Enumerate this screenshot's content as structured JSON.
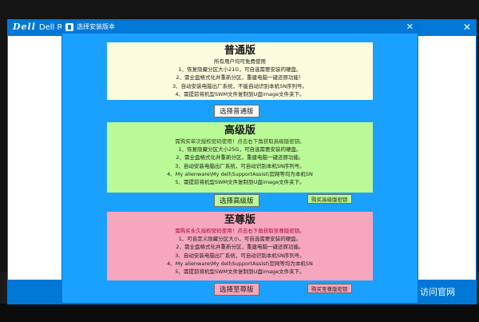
{
  "main_window": {
    "title": "Dell",
    "title_sub": "Dell Rec",
    "close": "✕",
    "visit_site": "访问官网"
  },
  "dialog": {
    "title": "选择安装版本",
    "close": "✕"
  },
  "editions": {
    "standard": {
      "title": "普通版",
      "lines": [
        "所有用户均可免费使用",
        "1、恢复隐藏分区大小21G，可自选需要安装的硬盘。",
        "2、需全盘格式化并重新分区，重建电脑一键还原功能！",
        "3、自动安装电脑出厂系统，不能自动识别本机SN序列号。",
        "4、需提前将机型SWM文件复制到U盘image文件夹下。"
      ],
      "select_label": "选择普通版"
    },
    "advanced": {
      "title": "高级版",
      "lines": [
        "需购买单次授权密码使用！点击右下角获取高级版密钥。",
        "1、恢复隐藏分区大小25G，可自选需要安装的硬盘。",
        "2、需全盘格式化并重新分区，重建电脑一键还原功能。",
        "3、自动安装电脑出厂系统，可自动识别本机SN序列号。",
        "4、My alienware\\My dell\\SupportAssist\\官网等均为本机SN",
        "5、需提前将机型SWM文件复制到U盘image文件夹下。"
      ],
      "select_label": "选择高级版",
      "buy_label": "购买高级版密钥"
    },
    "ultimate": {
      "title": "至尊版",
      "lines": [
        "需购买永久授权密码使用！点击右下角获取至尊版密钥。",
        "1、可自定义隐藏分区大小，可自选需要安装的硬盘。",
        "2、需全盘格式化并重新分区，重建电脑一键还原功能。",
        "3、自动安装电脑出厂系统，可自动识别本机SN序列号。",
        "4、My alienware\\My dell\\SupportAssist\\官网等均为本机SN",
        "5、需提前将机型SWM文件复制到U盘image文件夹下。"
      ],
      "select_label": "选择至尊版",
      "buy_label": "购买至尊版密钥"
    }
  },
  "icons": {
    "dialog_icon": "app-icon",
    "close_icon": "close-icon"
  },
  "colors": {
    "titlebar": "#0078d7",
    "dialog_bg": "#1aa1ff",
    "standard_bg": "#fdfbde",
    "advanced_bg": "#b9fa97",
    "ultimate_bg": "#f6a7bd"
  }
}
